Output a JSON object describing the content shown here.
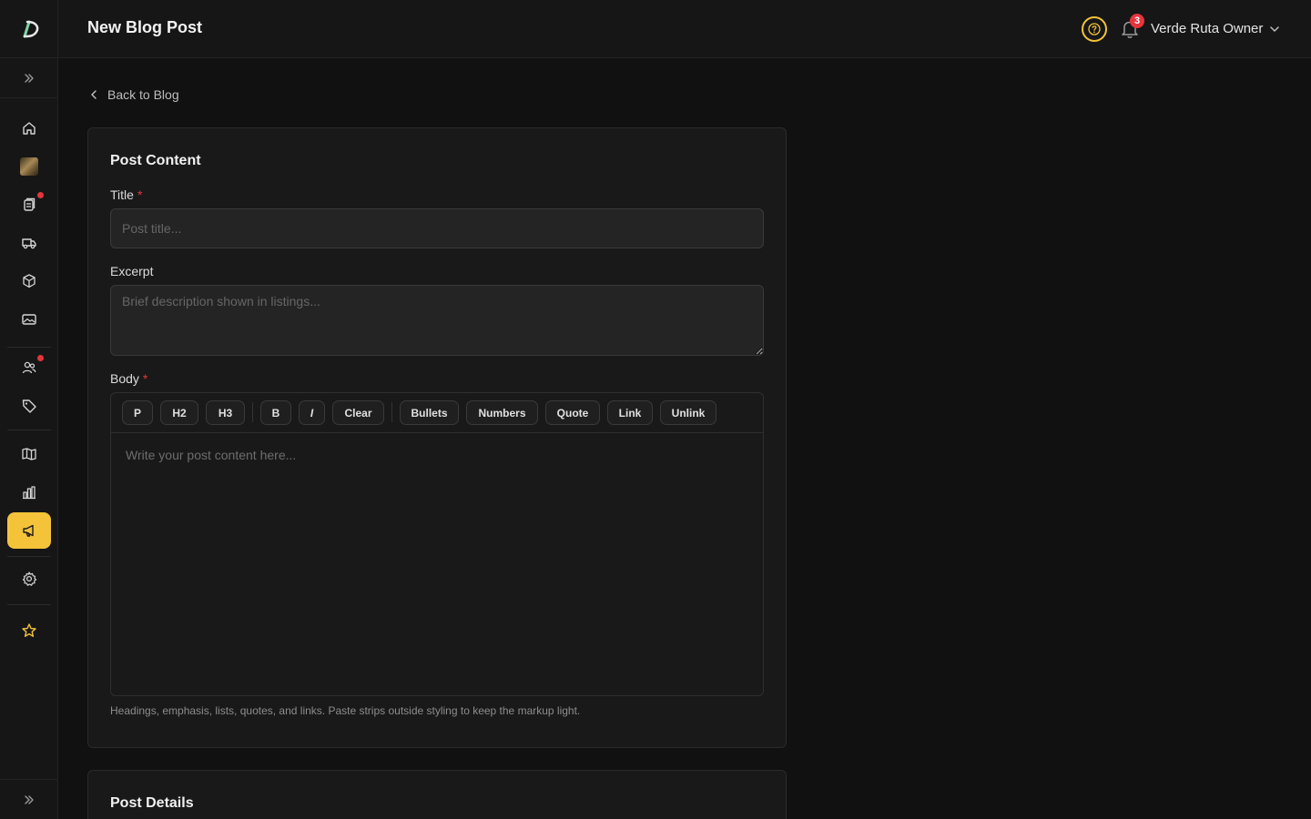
{
  "header": {
    "title": "New Blog Post",
    "notification_count": "3",
    "user_name": "Verde Ruta Owner"
  },
  "sidebar": {
    "items": [
      {
        "icon": "home-icon",
        "dot": false
      },
      {
        "icon": "photo-thumbnail",
        "dot": false
      },
      {
        "icon": "clipboard-icon",
        "dot": true
      },
      {
        "icon": "truck-icon",
        "dot": false
      },
      {
        "icon": "box-icon",
        "dot": false
      },
      {
        "icon": "image-icon",
        "dot": false
      },
      {
        "icon": "users-icon",
        "dot": true
      },
      {
        "icon": "tag-icon",
        "dot": false
      },
      {
        "icon": "book-icon",
        "dot": false
      },
      {
        "icon": "bar-chart-icon",
        "dot": false
      },
      {
        "icon": "megaphone-icon",
        "active": true
      },
      {
        "icon": "gear-icon",
        "dot": false
      },
      {
        "icon": "star-icon",
        "dot": false
      }
    ],
    "accent_color": "#f4c33a",
    "dot_color": "#e5353b"
  },
  "main": {
    "back_label": "Back to Blog",
    "content_card": {
      "title": "Post Content",
      "title_label": "Title",
      "title_placeholder": "Post title...",
      "excerpt_label": "Excerpt",
      "excerpt_placeholder": "Brief description shown in listings...",
      "body_label": "Body",
      "required_mark": "*",
      "toolbar": {
        "p": "P",
        "h2": "H2",
        "h3": "H3",
        "bold": "B",
        "italic": "I",
        "clear": "Clear",
        "bullets": "Bullets",
        "numbers": "Numbers",
        "quote": "Quote",
        "link": "Link",
        "unlink": "Unlink"
      },
      "body_placeholder": "Write your post content here...",
      "hint": "Headings, emphasis, lists, quotes, and links. Paste strips outside styling to keep the markup light."
    },
    "details_card": {
      "title": "Post Details"
    }
  }
}
